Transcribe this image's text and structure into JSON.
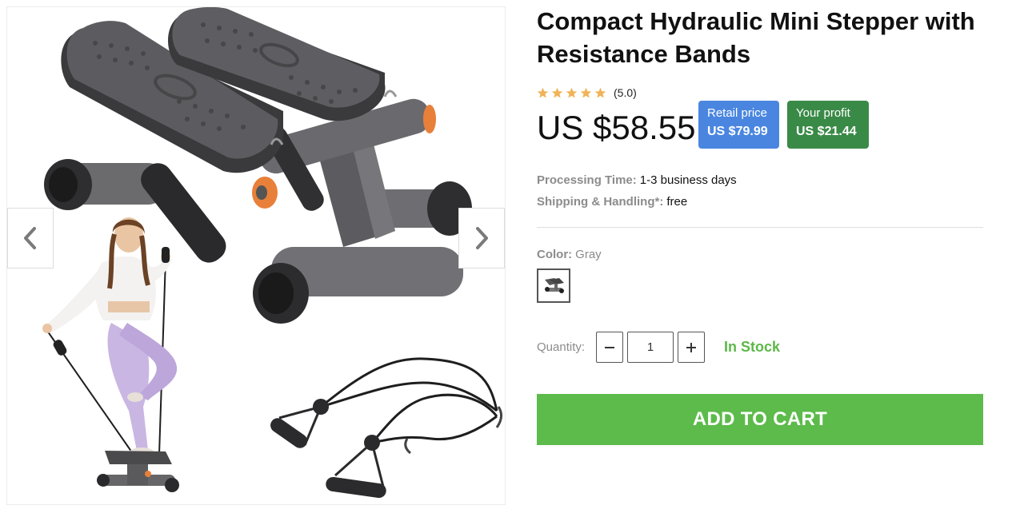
{
  "product": {
    "title": "Compact Hydraulic Mini Stepper with Resistance Bands",
    "rating": {
      "value": 5.0,
      "stars": 5,
      "text": "(5.0)"
    },
    "price": "US $58.55",
    "retail": {
      "label": "Retail price",
      "value": "US $79.99",
      "color": "#4a86e0"
    },
    "profit": {
      "label": "Your profit",
      "value": "US $21.44",
      "color": "#3a8a47"
    }
  },
  "shipping": {
    "processing_label": "Processing Time:",
    "processing_value": "1-3 business days",
    "handling_label": "Shipping & Handling*:",
    "handling_value": "free"
  },
  "options": {
    "color_label": "Color:",
    "color_value": "Gray"
  },
  "quantity": {
    "label": "Quantity:",
    "value": "1",
    "minus_icon": "minus-icon",
    "plus_icon": "plus-icon"
  },
  "stock": "In Stock",
  "cart": {
    "label": "ADD TO CART",
    "color": "#5cbb4a"
  },
  "gallery": {
    "prev_icon": "chevron-left-icon",
    "next_icon": "chevron-right-icon",
    "accent_color": "#e8803a"
  }
}
